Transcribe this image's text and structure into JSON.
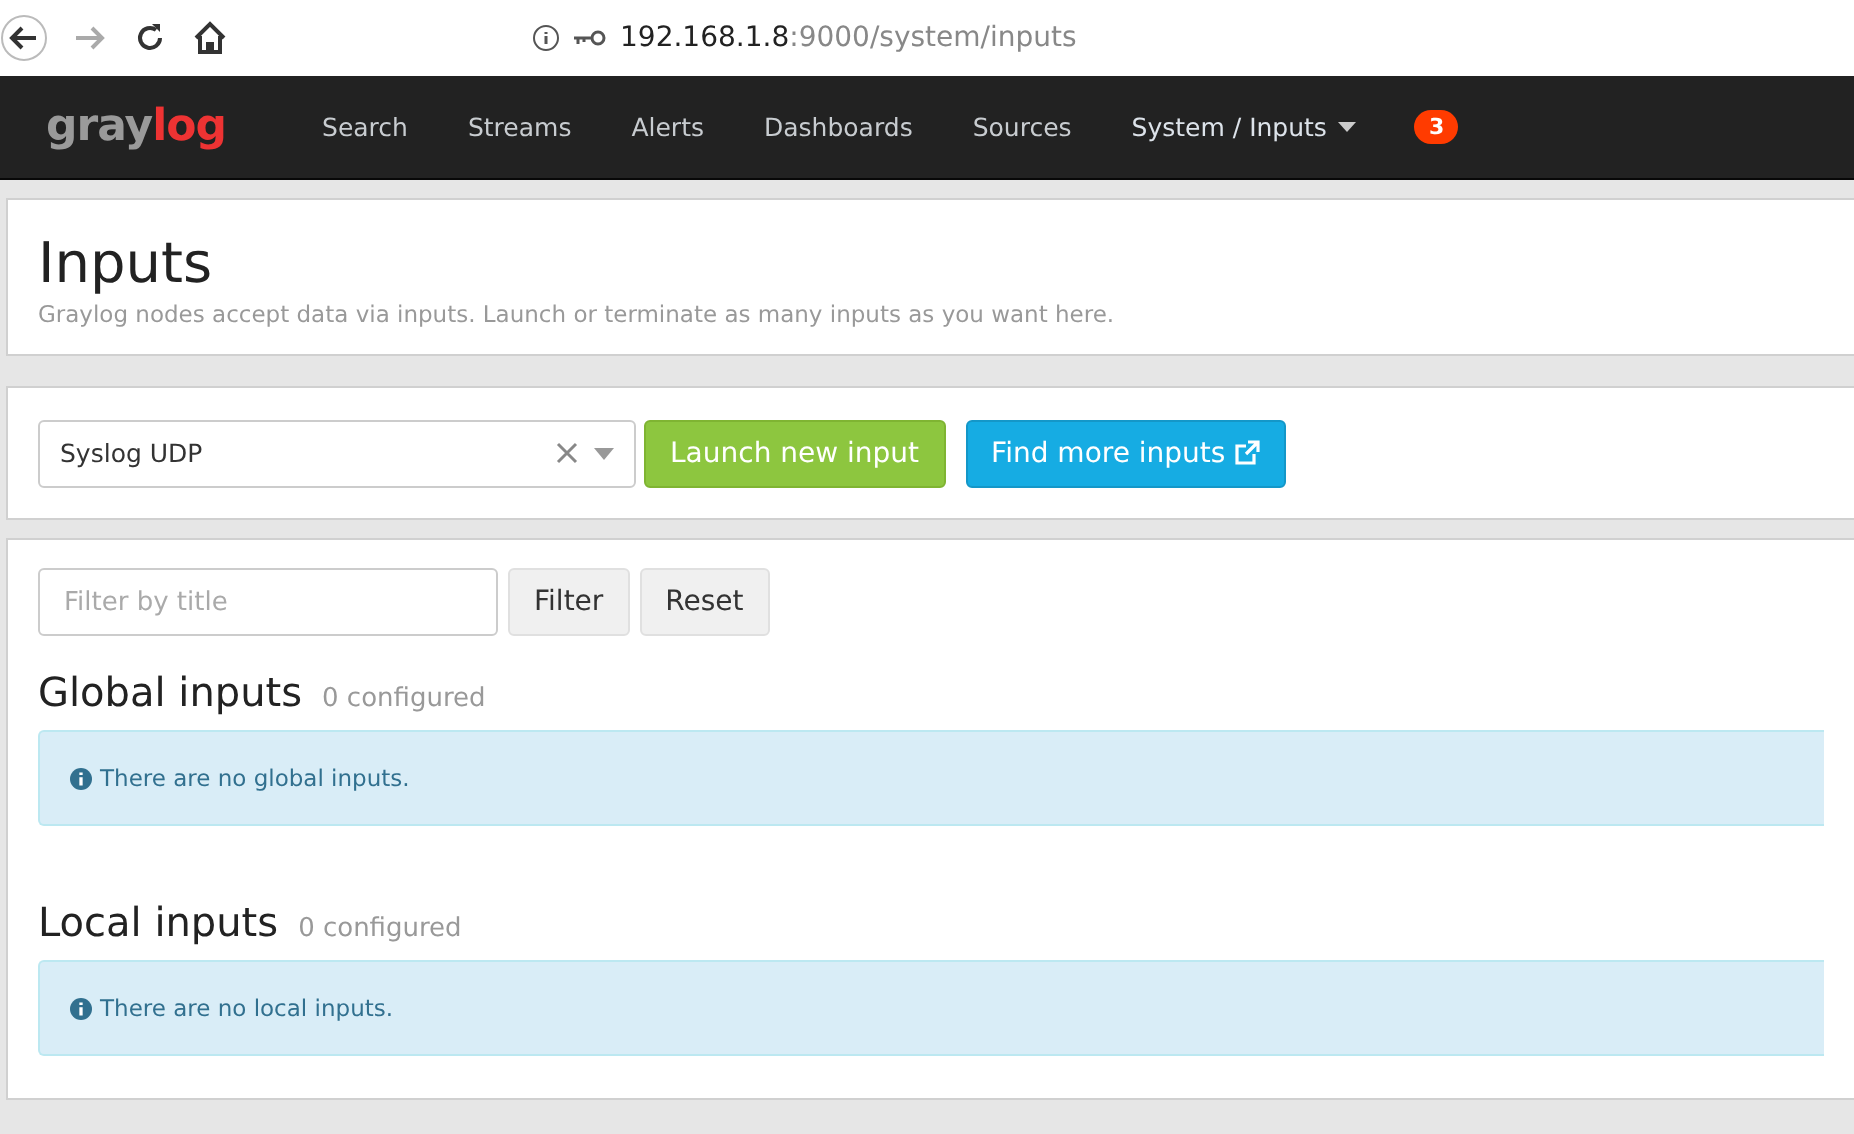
{
  "browser": {
    "url_host": "192.168.1.8",
    "url_rest": ":9000/system/inputs"
  },
  "navbar": {
    "logo": {
      "first": "gray",
      "second": "log"
    },
    "items": [
      {
        "label": "Search",
        "selected": false,
        "dropdown": false
      },
      {
        "label": "Streams",
        "selected": false,
        "dropdown": false
      },
      {
        "label": "Alerts",
        "selected": false,
        "dropdown": false
      },
      {
        "label": "Dashboards",
        "selected": false,
        "dropdown": false
      },
      {
        "label": "Sources",
        "selected": false,
        "dropdown": false
      },
      {
        "label": "System / Inputs",
        "selected": true,
        "dropdown": true
      }
    ],
    "notification_count": "3"
  },
  "header": {
    "title": "Inputs",
    "description": "Graylog nodes accept data via inputs. Launch or terminate as many inputs as you want here."
  },
  "launcher": {
    "select_value": "Syslog UDP",
    "launch_button": "Launch new input",
    "find_button": "Find more inputs"
  },
  "filter": {
    "placeholder": "Filter by title",
    "filter_button": "Filter",
    "reset_button": "Reset"
  },
  "sections": [
    {
      "title": "Global inputs",
      "count": "0 configured",
      "message": "There are no global inputs."
    },
    {
      "title": "Local inputs",
      "count": "0 configured",
      "message": "There are no local inputs."
    }
  ]
}
